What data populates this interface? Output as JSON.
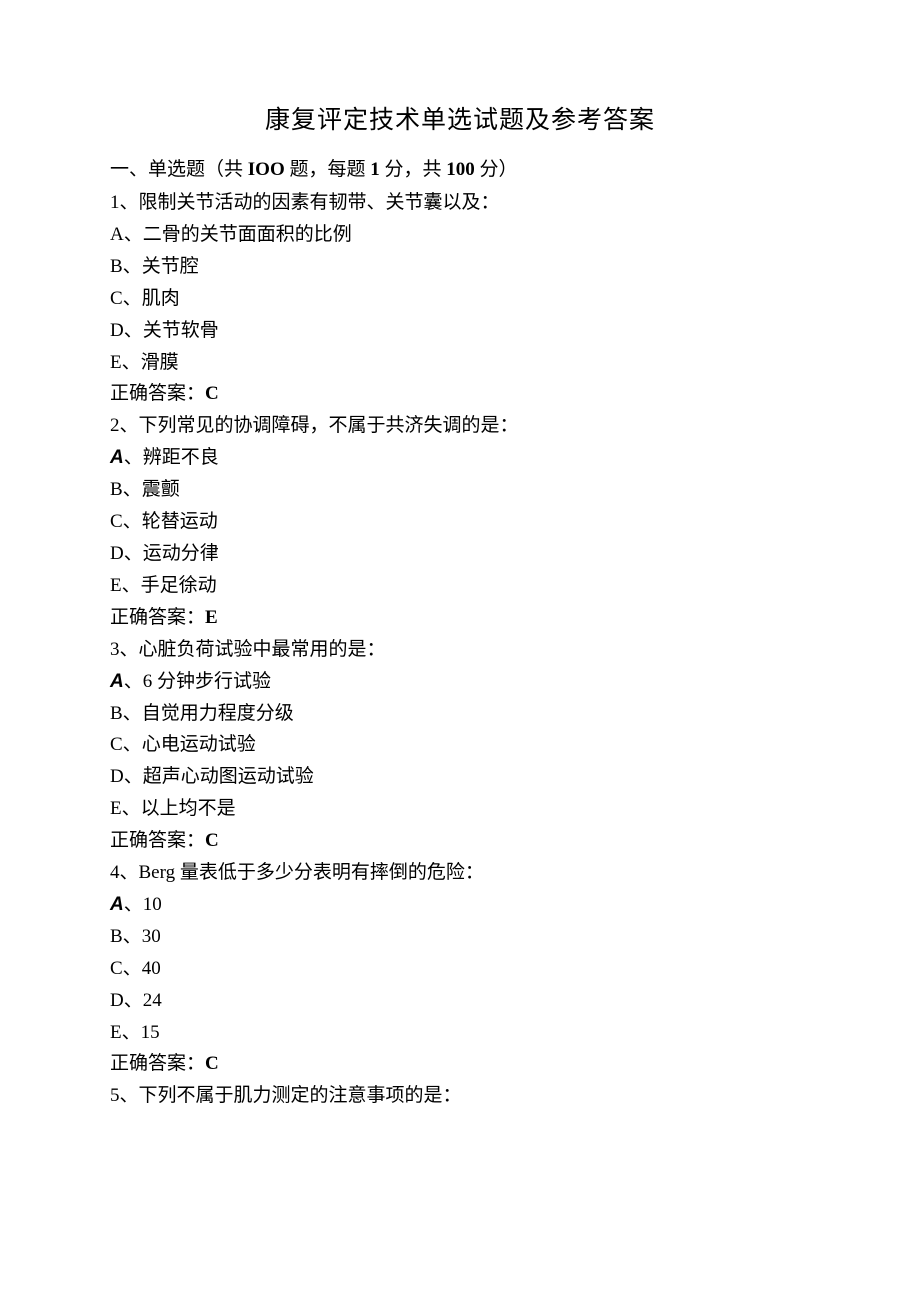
{
  "title": "康复评定技术单选试题及参考答案",
  "section_header": {
    "prefix": "一、单选题（共 ",
    "count_word": "IOO",
    "mid1": " 题，每题 ",
    "per": "1",
    "mid2": " 分，共 ",
    "total": "100",
    "suffix": " 分）"
  },
  "questions": [
    {
      "stem": "1、限制关节活动的因素有韧带、关节囊以及：",
      "options": [
        {
          "label": "A、",
          "text": "二骨的关节面面积的比例",
          "ital": false
        },
        {
          "label": "B、",
          "text": "关节腔",
          "ital": false
        },
        {
          "label": "C、",
          "text": "肌肉",
          "ital": false
        },
        {
          "label": "D、",
          "text": "关节软骨",
          "ital": false
        },
        {
          "label": "E、",
          "text": "滑膜",
          "ital": false
        }
      ],
      "answer_label": "正确答案：",
      "answer_value": "C"
    },
    {
      "stem": "2、下列常见的协调障碍，不属于共济失调的是：",
      "options": [
        {
          "label": "A、",
          "text": "辨距不良",
          "ital": true
        },
        {
          "label": "B、",
          "text": "震颤",
          "ital": false
        },
        {
          "label": "C、",
          "text": "轮替运动",
          "ital": false
        },
        {
          "label": "D、",
          "text": "运动分律",
          "ital": false
        },
        {
          "label": "E、",
          "text": "手足徐动",
          "ital": false
        }
      ],
      "answer_label": "正确答案：",
      "answer_value": "E"
    },
    {
      "stem": "3、心脏负荷试验中最常用的是：",
      "options": [
        {
          "label": "A、",
          "text": "6 分钟步行试验",
          "ital": true
        },
        {
          "label": "B、",
          "text": "自觉用力程度分级",
          "ital": false
        },
        {
          "label": "C、",
          "text": "心电运动试验",
          "ital": false
        },
        {
          "label": "D、",
          "text": "超声心动图运动试验",
          "ital": false
        },
        {
          "label": "E、",
          "text": "以上均不是",
          "ital": false
        }
      ],
      "answer_label": "正确答案：",
      "answer_value": "C"
    },
    {
      "stem": "4、Berg 量表低于多少分表明有摔倒的危险：",
      "options": [
        {
          "label": "A、",
          "text": "10",
          "ital": true
        },
        {
          "label": "B、",
          "text": "30",
          "ital": false
        },
        {
          "label": "C、",
          "text": "40",
          "ital": false
        },
        {
          "label": "D、",
          "text": "24",
          "ital": false
        },
        {
          "label": "E、",
          "text": "15",
          "ital": false
        }
      ],
      "answer_label": "正确答案：",
      "answer_value": "C"
    },
    {
      "stem": "5、下列不属于肌力测定的注意事项的是：",
      "options": [],
      "answer_label": "",
      "answer_value": ""
    }
  ]
}
